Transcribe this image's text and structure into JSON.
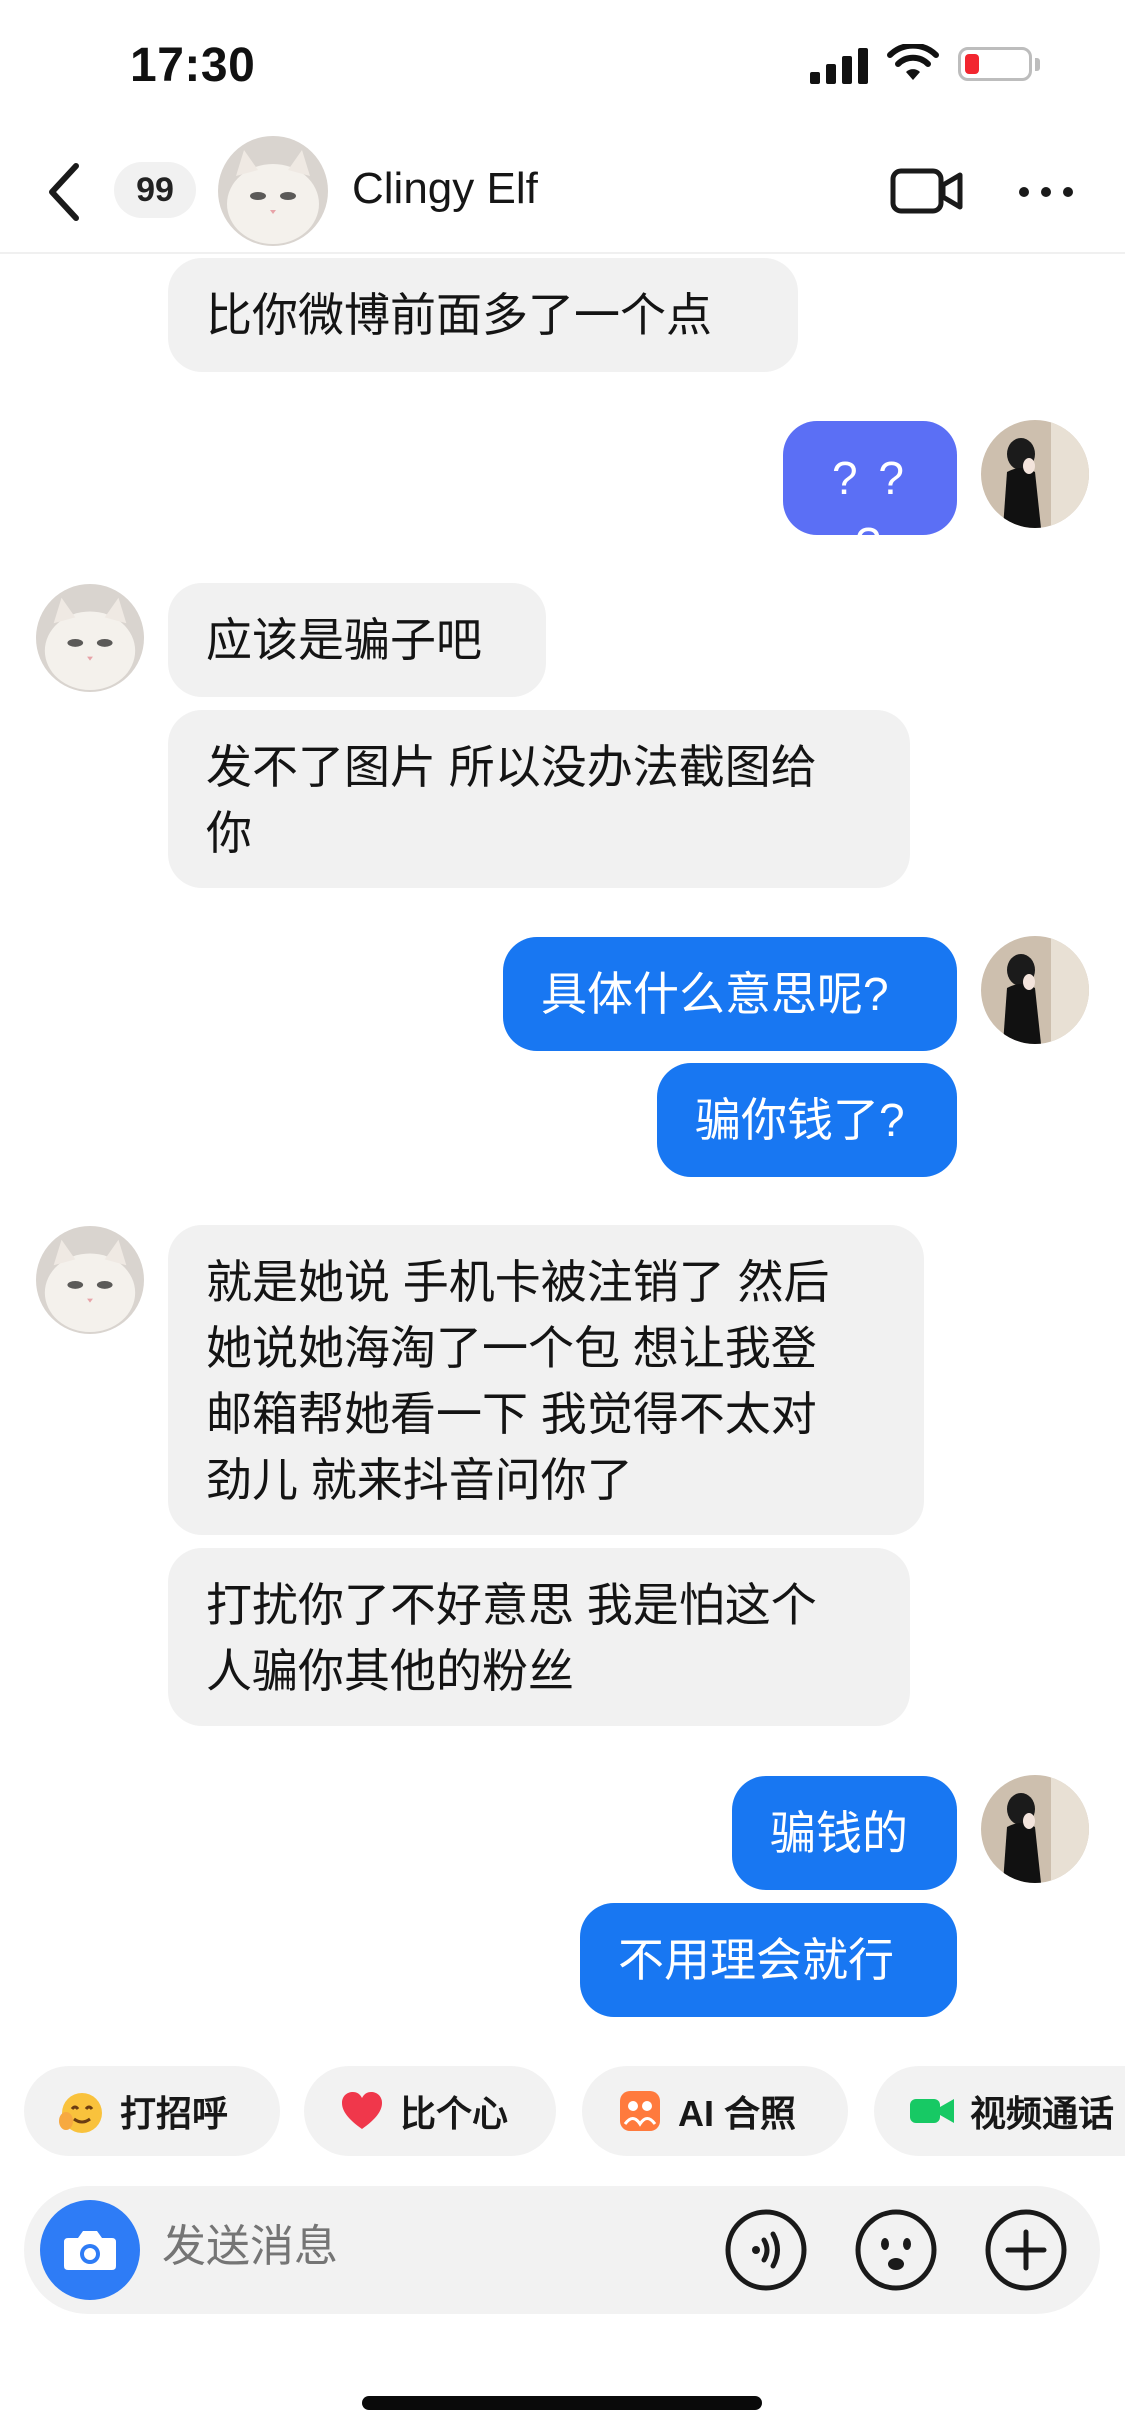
{
  "status_bar": {
    "time": "17:30",
    "battery_color": "#f2262f"
  },
  "header": {
    "unread_count": "99",
    "contact_name": "Clingy Elf",
    "icons": [
      "back-chevron-icon",
      "video-call-icon",
      "more-icon"
    ]
  },
  "messages": [
    {
      "from": "contact",
      "text": "比你微博前面多了一个点"
    },
    {
      "from": "me",
      "text": "? ? ?"
    },
    {
      "from": "contact",
      "text": "应该是骗子吧"
    },
    {
      "from": "contact",
      "text": "发不了图片 所以没办法截图给\n你"
    },
    {
      "from": "me",
      "text": "具体什么意思呢?"
    },
    {
      "from": "me",
      "text": "骗你钱了?"
    },
    {
      "from": "contact",
      "text": "就是她说 手机卡被注销了 然后\n她说她海淘了一个包 想让我登\n邮箱帮她看一下 我觉得不太对\n劲儿 就来抖音问你了"
    },
    {
      "from": "contact",
      "text": "打扰你了不好意思 我是怕这个\n人骗你其他的粉丝"
    },
    {
      "from": "me",
      "text": "骗钱的"
    },
    {
      "from": "me",
      "text": "不用理会就行"
    }
  ],
  "quick_actions": [
    {
      "label": "打招呼",
      "icon": "wave-emoji-icon"
    },
    {
      "label": "比个心",
      "icon": "heart-icon"
    },
    {
      "label": "AI 合照",
      "icon": "ai-photo-icon"
    },
    {
      "label": "视频通话",
      "icon": "video-call-icon"
    }
  ],
  "composer": {
    "placeholder": "发送消息",
    "icons": [
      "camera-icon",
      "voice-icon",
      "emoji-icon",
      "plus-icon"
    ]
  },
  "colors": {
    "sent_bubble_purple": "#5b6ff5",
    "sent_bubble_blue": "#1877f2",
    "received_bubble": "#f1f1f1",
    "camera_button": "#2e7cf6"
  }
}
